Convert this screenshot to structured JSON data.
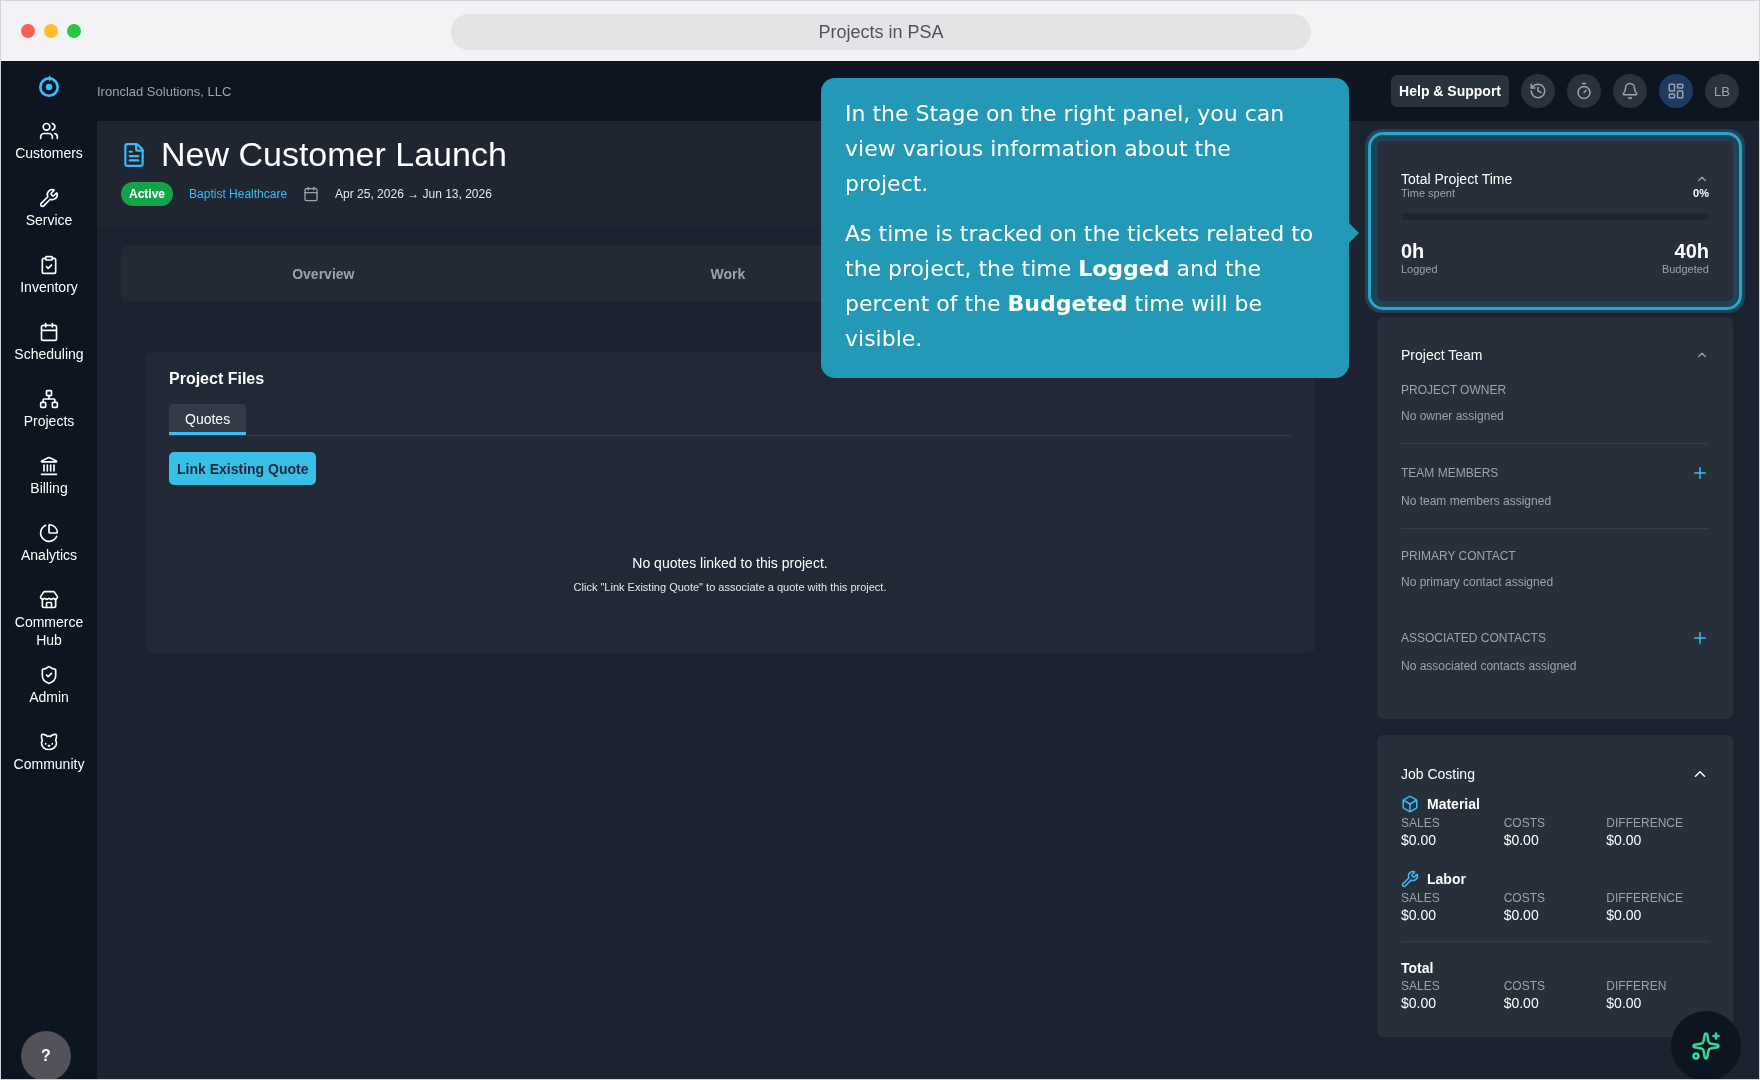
{
  "window": {
    "title": "Projects in PSA"
  },
  "topbar": {
    "company": "Ironclad Solutions, LLC",
    "help_button": "Help & Support",
    "avatar": "LB"
  },
  "sidebar": {
    "items": [
      {
        "label": "Customers",
        "kind": "users"
      },
      {
        "label": "Service",
        "kind": "tools"
      },
      {
        "label": "Inventory",
        "kind": "clipboard"
      },
      {
        "label": "Scheduling",
        "kind": "calendar"
      },
      {
        "label": "Projects",
        "kind": "network"
      },
      {
        "label": "Billing",
        "kind": "bank"
      },
      {
        "label": "Analytics",
        "kind": "pie"
      },
      {
        "label": "Commerce Hub",
        "kind": "store"
      },
      {
        "label": "Admin",
        "kind": "shield"
      },
      {
        "label": "Community",
        "kind": "community"
      }
    ]
  },
  "project": {
    "title": "New Customer Launch",
    "status": "Active",
    "customer": "Baptist Healthcare",
    "dates": "Apr 25, 2026 → Jun 13, 2026"
  },
  "tabs": [
    {
      "label": "Overview",
      "selected": false
    },
    {
      "label": "Work",
      "selected": false
    }
  ],
  "files": {
    "title": "Project Files",
    "tabs": [
      {
        "label": "Quotes",
        "selected": true
      }
    ],
    "button": "Link Existing Quote",
    "empty_title": "No quotes linked to this project.",
    "empty_hint": "Click \"Link Existing Quote\" to associate a quote with this project."
  },
  "time_card": {
    "title": "Total Project Time",
    "subtitle": "Time spent",
    "percent": "0%",
    "level": 0,
    "logged": "0h",
    "logged_label": "Logged",
    "budgeted": "40h",
    "budgeted_label": "Budgeted",
    "expanded": true,
    "highlighted": true
  },
  "team": {
    "title": "Project Team",
    "expanded": true,
    "fields": [
      {
        "label": "PROJECT OWNER",
        "value": "No owner assigned",
        "addable": false
      },
      {
        "label": "TEAM MEMBERS",
        "value": "No team members assigned",
        "addable": true
      },
      {
        "label": "PRIMARY CONTACT",
        "value": "No primary contact assigned",
        "addable": false
      },
      {
        "label": "ASSOCIATED CONTACTS",
        "value": "No associated contacts assigned",
        "addable": true
      }
    ]
  },
  "costing": {
    "title": "Job Costing",
    "expanded": true,
    "groups": [
      {
        "name": "Material",
        "kind": "material",
        "columns": [
          {
            "label": "SALES",
            "value": "$0.00"
          },
          {
            "label": "COSTS",
            "value": "$0.00"
          },
          {
            "label": "DIFFERENCE",
            "value": "$0.00"
          }
        ]
      },
      {
        "name": "Labor",
        "kind": "labor",
        "columns": [
          {
            "label": "SALES",
            "value": "$0.00"
          },
          {
            "label": "COSTS",
            "value": "$0.00"
          },
          {
            "label": "DIFFERENCE",
            "value": "$0.00"
          }
        ]
      },
      {
        "name": "Total",
        "kind": "total",
        "columns": [
          {
            "label": "SALES",
            "value": "$0.00"
          },
          {
            "label": "COSTS",
            "value": "$0.00"
          },
          {
            "label": "DIFFEREN",
            "value": "$0.00"
          }
        ]
      }
    ]
  },
  "tooltip": {
    "paragraphs": [
      "In the Stage on the right panel, you can view various information about the project.",
      "As time is tracked on the tickets related to the project, the time **Logged** and the percent of the **Budgeted** time will be visible."
    ]
  },
  "help_fab": "?"
}
